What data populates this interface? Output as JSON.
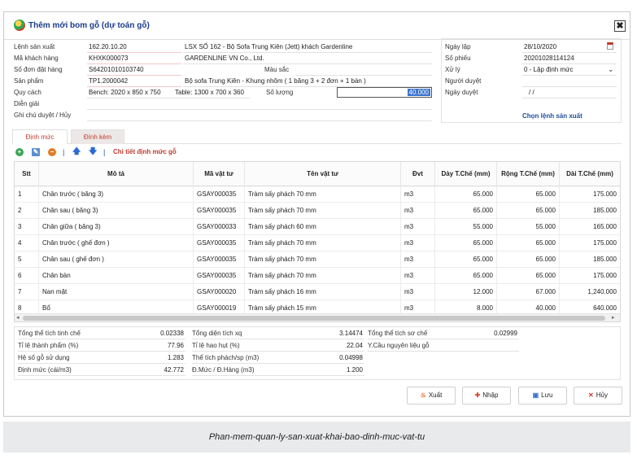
{
  "dialog": {
    "title": "Thêm mới bom gỗ (dự toán gỗ)",
    "close": "✖"
  },
  "form": {
    "lenh_label": "Lệnh sản xuất",
    "lenh_code": "162.20.10.20",
    "lenh_desc": "LSX SỐ 162 - Bộ Sofa Trung Kiên (Jett) khách Gardenline",
    "kh_label": "Mã khách hàng",
    "kh_code": "KHXK000073",
    "kh_name": "GARDENLINE VN Co., Ltd.",
    "dh_label": "Số đơn đặt hàng",
    "dh_code": "S64201010103740",
    "mausac_label": "Màu sắc",
    "sp_label": "Sản phẩm",
    "sp_code": "TP1.2000042",
    "sp_desc": "Bộ sofa Trung Kiên - Khung nhôm ( 1 băng 3 + 2 đơn + 1 bàn )",
    "qc_label": "Quy cách",
    "qc_bench": "Bench: 2020 x 850 x 750",
    "qc_table": "Table: 1300 x 700 x 360",
    "sl_label": "Số lượng",
    "sl_value": "40.000",
    "dg_label": "Diễn giải",
    "gc_label": "Ghi chú duyệt / Hủy"
  },
  "right": {
    "ngaylap_label": "Ngày lập",
    "ngaylap": "28/10/2020",
    "sophieu_label": "Số phiếu",
    "sophieu": "20201028114124",
    "xuly_label": "Xử lý",
    "xuly": "0 - Lập định mức",
    "nguoiduyet_label": "Người duyệt",
    "ngayduyet_label": "Ngày duyệt",
    "ngayduyet": "/ /",
    "chon_link": "Chọn lệnh sản xuất"
  },
  "tabs": [
    "Định mức",
    "Đính kèm"
  ],
  "toolbar": {
    "link": "Chi tiết định mức gỗ"
  },
  "grid": {
    "headers": [
      "Stt",
      "Mô tả",
      "Mã vật tư",
      "Tên vật tư",
      "Đvt",
      "Dày T.Chế (mm)",
      "Rộng T.Chế (mm)",
      "Dài T.Chế (mm)"
    ],
    "rows": [
      [
        "1",
        "Chân trước ( băng 3)",
        "GSAY000035",
        "Tràm sấy phách 70 mm",
        "m3",
        "65.000",
        "65.000",
        "175.000"
      ],
      [
        "2",
        "Chân sau ( băng 3)",
        "GSAY000035",
        "Tràm sấy phách 70 mm",
        "m3",
        "65.000",
        "65.000",
        "185.000"
      ],
      [
        "3",
        "Chân giữa ( băng 3)",
        "GSAY000033",
        "Tràm sấy phách 60 mm",
        "m3",
        "55.000",
        "55.000",
        "165.000"
      ],
      [
        "4",
        "Chân trước ( ghế đơn )",
        "GSAY000035",
        "Tràm sấy phách 70 mm",
        "m3",
        "65.000",
        "65.000",
        "175.000"
      ],
      [
        "5",
        "Chân sau ( ghế đơn )",
        "GSAY000035",
        "Tràm sấy phách 70 mm",
        "m3",
        "65.000",
        "65.000",
        "185.000"
      ],
      [
        "6",
        "Chân bàn",
        "GSAY000035",
        "Tràm sấy phách 70 mm",
        "m3",
        "65.000",
        "65.000",
        "175.000"
      ],
      [
        "7",
        "Nan mặt",
        "GSAY000020",
        "Tràm sấy phách 16 mm",
        "m3",
        "12.000",
        "67.000",
        "1,240.000"
      ],
      [
        "8",
        "Bổ",
        "GSAY000019",
        "Tràm sấy phách 15 mm",
        "m3",
        "8.000",
        "40.000",
        "640.000"
      ]
    ]
  },
  "summary": {
    "c1": [
      [
        "Tổng thể tích tinh chế",
        "0.02338"
      ],
      [
        "Tỉ lệ thành phẩm (%)",
        "77.96"
      ],
      [
        "Hệ số gỗ sử dụng",
        "1.283"
      ],
      [
        "Định mức (cái/m3)",
        "42.772"
      ]
    ],
    "c2": [
      [
        "Tổng diện tích xq",
        "3.14474"
      ],
      [
        "Tỉ lệ hao hụt (%)",
        "22.04"
      ],
      [
        "Thể tích phách/sp (m3)",
        "0.04998"
      ],
      [
        "Đ.Mức / Đ.Hàng (m3)",
        "1.200"
      ]
    ],
    "c3": [
      [
        "Tổng thể tích sơ chế",
        "0.02999"
      ],
      [
        "Y.Cầu nguyên liệu gỗ",
        ""
      ]
    ]
  },
  "buttons": {
    "xuat": "Xuất",
    "nhap": "Nhập",
    "luu": "Lưu",
    "huy": "Hủy"
  },
  "caption": "Phan-mem-quan-ly-san-xuat-khai-bao-dinh-muc-vat-tu"
}
